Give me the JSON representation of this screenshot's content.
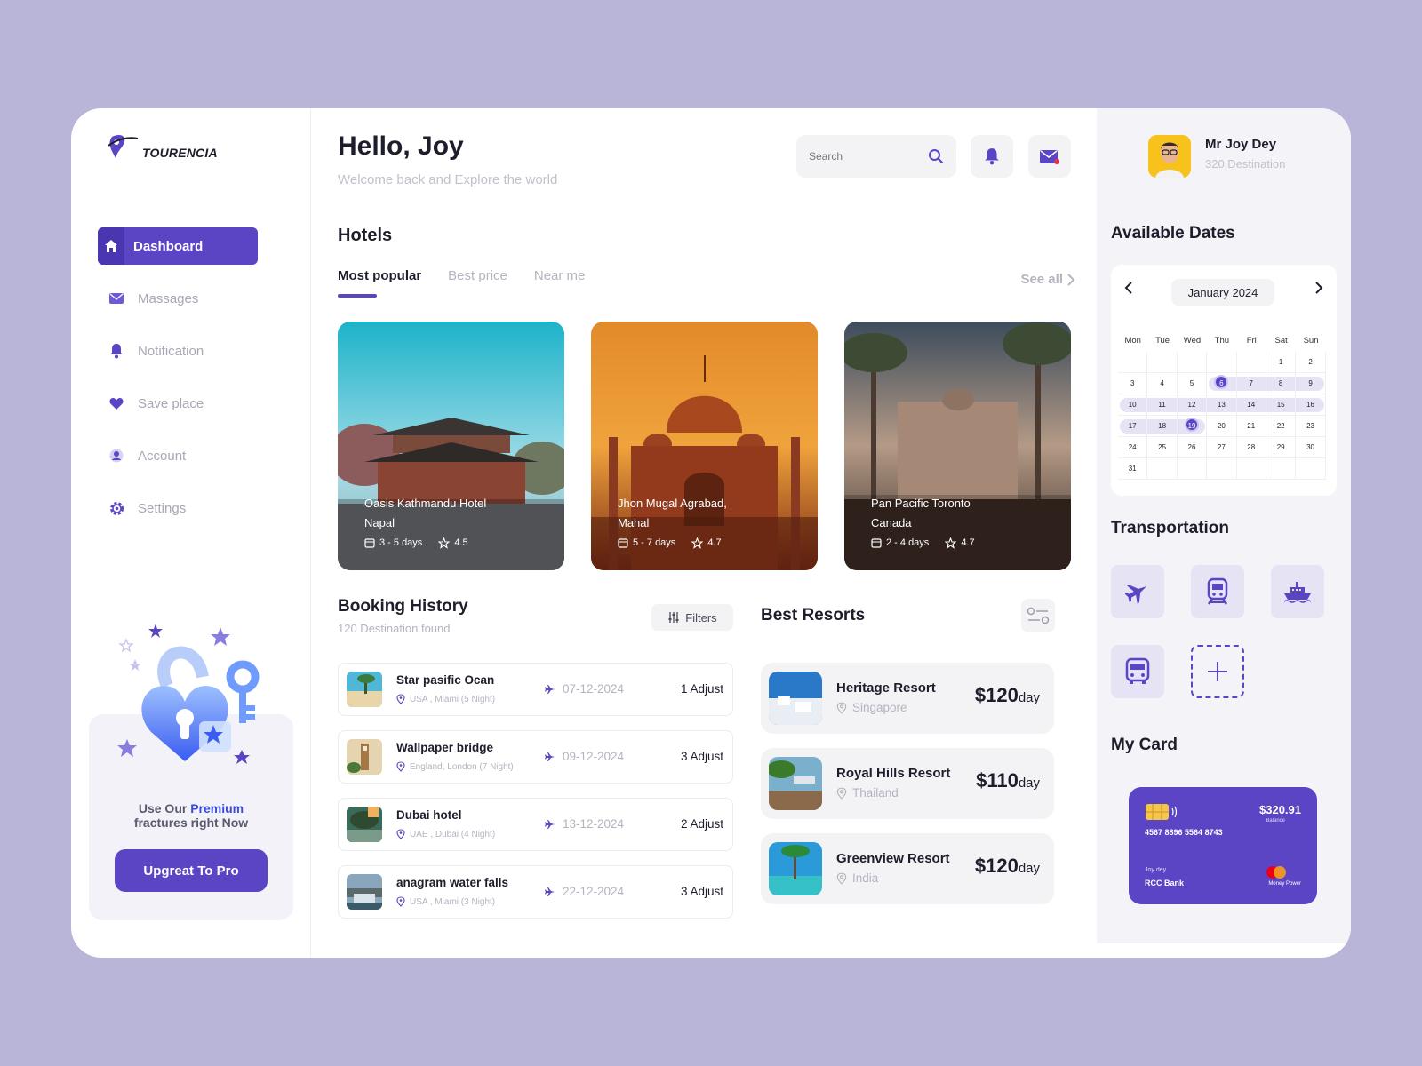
{
  "brand": {
    "name": "TOURENCIA"
  },
  "nav": {
    "items": [
      {
        "label": "Dashboard",
        "icon": "home-icon"
      },
      {
        "label": "Massages",
        "icon": "mail-icon"
      },
      {
        "label": "Notification",
        "icon": "bell-icon"
      },
      {
        "label": "Save place",
        "icon": "heart-icon"
      },
      {
        "label": "Account",
        "icon": "user-icon"
      },
      {
        "label": "Settings",
        "icon": "gear-icon"
      }
    ]
  },
  "promo": {
    "line1_pre": "Use Our ",
    "line1_hl": "Premium",
    "line2": "fractures right Now",
    "button": "Upgreat To Pro"
  },
  "header": {
    "greeting": "Hello, Joy",
    "subtitle": "Welcome back and Explore the world",
    "search_placeholder": "Search"
  },
  "hotels": {
    "title": "Hotels",
    "tabs": [
      "Most popular",
      "Best price",
      "Near me"
    ],
    "see_all": "See all",
    "items": [
      {
        "name": "Oasis Kathmandu Hotel",
        "place": "Napal",
        "days": "3 - 5 days",
        "rating": "4.5"
      },
      {
        "name": "Jhon Mugal Agrabad,",
        "place": "Mahal",
        "days": "5 - 7 days",
        "rating": "4.7"
      },
      {
        "name": "Pan Pacific Toronto",
        "place": "Canada",
        "days": "2 - 4 days",
        "rating": "4.7"
      }
    ]
  },
  "booking": {
    "title": "Booking History",
    "subtitle": "120 Destination found",
    "filters": "Filters",
    "items": [
      {
        "name": "Star pasific Ocan",
        "location": "USA , Miami (5 Night)",
        "date": "07-12-2024",
        "adjust": "1 Adjust"
      },
      {
        "name": "Wallpaper bridge",
        "location": "England, London (7 Night)",
        "date": "09-12-2024",
        "adjust": "3 Adjust"
      },
      {
        "name": "Dubai hotel",
        "location": "UAE , Dubai (4 Night)",
        "date": "13-12-2024",
        "adjust": "2 Adjust"
      },
      {
        "name": "anagram water falls",
        "location": "USA , Miami (3 Night)",
        "date": "22-12-2024",
        "adjust": "3 Adjust"
      }
    ]
  },
  "resorts": {
    "title": "Best Resorts",
    "items": [
      {
        "name": "Heritage Resort",
        "location": "Singapore",
        "price": "$120",
        "unit": "day"
      },
      {
        "name": "Royal Hills Resort",
        "location": "Thailand",
        "price": "$110",
        "unit": "day"
      },
      {
        "name": "Greenview Resort",
        "location": "India",
        "price": "$120",
        "unit": "day"
      }
    ]
  },
  "profile": {
    "name": "Mr Joy Dey",
    "destinations": "320 Destination"
  },
  "calendar": {
    "title": "Available Dates",
    "month": "January 2024",
    "weekdays": [
      "Mon",
      "Tue",
      "Wed",
      "Thu",
      "Fri",
      "Sat",
      "Sun"
    ],
    "weeks": [
      [
        "",
        "",
        "",
        "",
        "",
        "1",
        "2"
      ],
      [
        "3",
        "4",
        "5",
        "6",
        "7",
        "8",
        "9"
      ],
      [
        "10",
        "11",
        "12",
        "13",
        "14",
        "15",
        "16"
      ],
      [
        "17",
        "18",
        "19",
        "20",
        "21",
        "22",
        "23"
      ],
      [
        "24",
        "25",
        "26",
        "27",
        "28",
        "29",
        "30"
      ],
      [
        "31",
        "",
        "",
        "",
        "",
        "",
        ""
      ]
    ],
    "selected": [
      "6",
      "19"
    ]
  },
  "transportation": {
    "title": "Transportation",
    "items": [
      "plane-icon",
      "train-icon",
      "ship-icon",
      "bus-icon",
      "plus-icon"
    ]
  },
  "card": {
    "title": "My Card",
    "balance": "$320.91",
    "balance_label": "Balance",
    "number": "4567 8896 5564 8743",
    "holder": "Joy dey",
    "bank": "RCC Bank",
    "network": "Money Power"
  },
  "colors": {
    "accent": "#5b45c5",
    "background": "#b9b5d9"
  }
}
